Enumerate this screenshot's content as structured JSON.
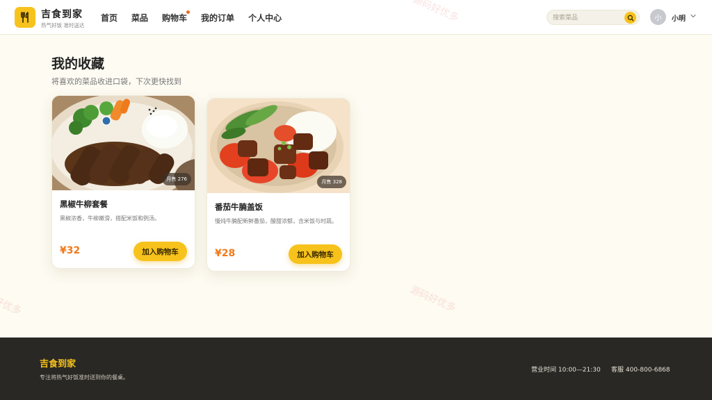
{
  "header": {
    "brand_name": "吉食到家",
    "brand_tagline": "热气好饭 准时送达",
    "nav": [
      {
        "label": "首页",
        "has_dot": false
      },
      {
        "label": "菜品",
        "has_dot": false
      },
      {
        "label": "购物车",
        "has_dot": true
      },
      {
        "label": "我的订单",
        "has_dot": false
      },
      {
        "label": "个人中心",
        "has_dot": false
      }
    ],
    "search_placeholder": "搜索菜品",
    "user": {
      "avatar_letter": "小",
      "name": "小明"
    }
  },
  "main": {
    "title": "我的收藏",
    "subtitle": "将喜欢的菜品收进口袋，下次更快找到",
    "cards": [
      {
        "name": "黑椒牛柳套餐",
        "desc": "黑椒浓香，牛柳嫩滑，搭配米饭和例汤。",
        "price": "¥32",
        "sales": "月售 276",
        "button": "加入购物车"
      },
      {
        "name": "番茄牛腩盖饭",
        "desc": "慢炖牛腩配新鲜番茄，酸甜浓郁，含米饭与时蔬。",
        "price": "¥28",
        "sales": "月售 328",
        "button": "加入购物车"
      }
    ]
  },
  "watermarks": [
    "源码好优多",
    "好优多",
    "源码好优多"
  ],
  "footer": {
    "brand": "吉食到家",
    "slogan": "专注将热气好饭准时送到你的餐桌。",
    "hours": "营业时间 10:00—21:30",
    "service": "客服 400-800-6868"
  },
  "colors": {
    "accent": "#f7c21b",
    "price": "#f07a1c",
    "footer_bg": "#2a2825",
    "page_bg": "#fdfbf2"
  }
}
